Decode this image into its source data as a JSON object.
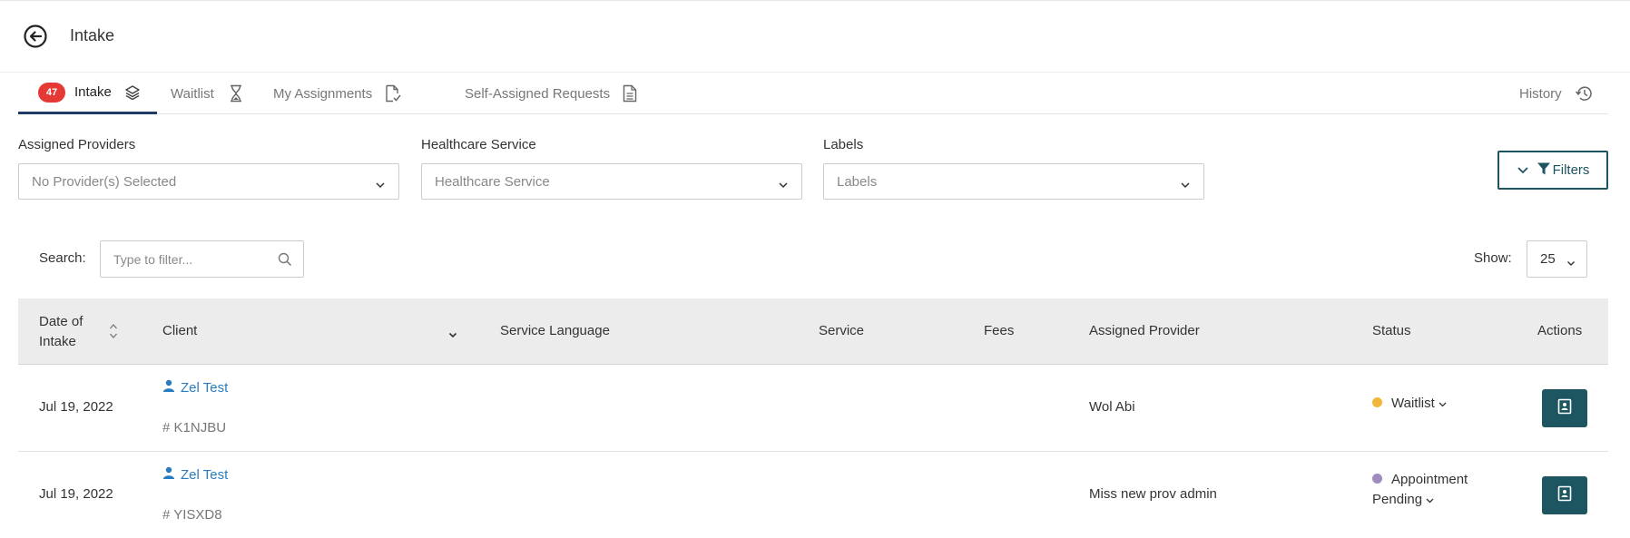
{
  "header": {
    "title": "Intake"
  },
  "tabs": [
    {
      "label": "Intake",
      "badge": "47",
      "icon": "layers-icon"
    },
    {
      "label": "Waitlist",
      "icon": "hourglass-icon"
    },
    {
      "label": "My Assignments",
      "icon": "doc-check-icon"
    },
    {
      "label": "Self-Assigned Requests",
      "icon": "document-icon"
    },
    {
      "label": "History",
      "icon": "history-icon"
    }
  ],
  "filters": {
    "providers": {
      "label": "Assigned Providers",
      "value": "No Provider(s) Selected"
    },
    "service": {
      "label": "Healthcare Service",
      "value": "Healthcare Service"
    },
    "labels": {
      "label": "Labels",
      "value": "Labels"
    },
    "button_label": "Filters"
  },
  "search": {
    "label": "Search:",
    "placeholder": "Type to filter..."
  },
  "show": {
    "label": "Show:",
    "value": "25"
  },
  "table": {
    "headers": {
      "date_line1": "Date of",
      "date_line2": "Intake",
      "client": "Client",
      "language": "Service Language",
      "service": "Service",
      "fees": "Fees",
      "provider": "Assigned Provider",
      "status": "Status",
      "actions": "Actions"
    },
    "rows": [
      {
        "date": "Jul 19, 2022",
        "client": "Zel Test",
        "client_id": "# K1NJBU",
        "provider": "Wol Abi",
        "status": "Waitlist",
        "status_color": "#f2b73a"
      },
      {
        "date": "Jul 19, 2022",
        "client": "Zel Test",
        "client_id": "# YISXD8",
        "provider": "Miss new prov admin",
        "status": "Appointment Pending",
        "status_color": "#9f8bbf"
      }
    ]
  },
  "colors": {
    "accent": "#1d5560",
    "tab_underline": "#1f3a66",
    "badge": "#e53935",
    "link": "#2a7cc0"
  }
}
